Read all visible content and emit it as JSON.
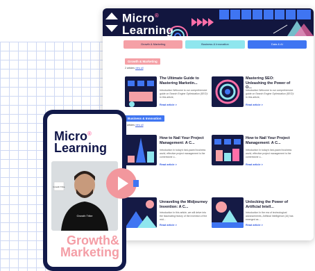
{
  "brand": {
    "line1": "Micro",
    "line2": "Learning",
    "reg": "®"
  },
  "tabs": [
    "Growth & Marketing",
    "Business & Innovation",
    "Data & AI"
  ],
  "sections": [
    {
      "title": "Growth & Marketing",
      "count": "2 articles",
      "view": "view all",
      "color": "#f5a0a6",
      "cards": [
        {
          "title": "The Ultimate Guide to Mastering Marketin...",
          "desc": "Introduction Welcome to our comprehensive guide on Search Engine Optimization (SEO)! In this article,",
          "link": "Read article >"
        },
        {
          "title": "Mastering SEO: Unleashing the Power of O...",
          "desc": "Introduction Welcome to our comprehensive guide on Search Engine Optimization (SEO)! In this article,",
          "link": "Read article >"
        }
      ]
    },
    {
      "title": "Business & Innovation",
      "count": "2 articles",
      "view": "view all",
      "color": "#3f75f2",
      "cards": [
        {
          "title": "How to Nail Your Project Management: A C...",
          "desc": "Introduction In today's fast-paced business world, effective project management is the cornerstone o...",
          "link": "Read article >"
        },
        {
          "title": "How to Nail Your Project Management: A C...",
          "desc": "Introduction In today's fast-paced business world, effective project management is the cornerstone o...",
          "link": "Read article >"
        }
      ]
    },
    {
      "cards": [
        {
          "title": "Unraveling the Midjourney Invention: A C...",
          "desc": "Introduction In this article, we will delve into the fascinating history of the invention of the mid...",
          "link": "Read article >"
        },
        {
          "title": "Unlocking the Power of Artificial Intell...",
          "desc": "Introduction In the era of technological advancements, Artificial Intelligence (AI) has emerged as ...",
          "link": "Read article >"
        }
      ]
    }
  ],
  "phone": {
    "line1": "Micro",
    "line2": "Learning",
    "badge": "Growth Tribe",
    "shirt": "Growth Tribe",
    "footer1": "Growth&",
    "footer2": "Marketing"
  },
  "colors": {
    "navy": "#12163f",
    "pink": "#f5a0a6",
    "cyan": "#8fe6ee",
    "blue": "#3f75f2"
  }
}
